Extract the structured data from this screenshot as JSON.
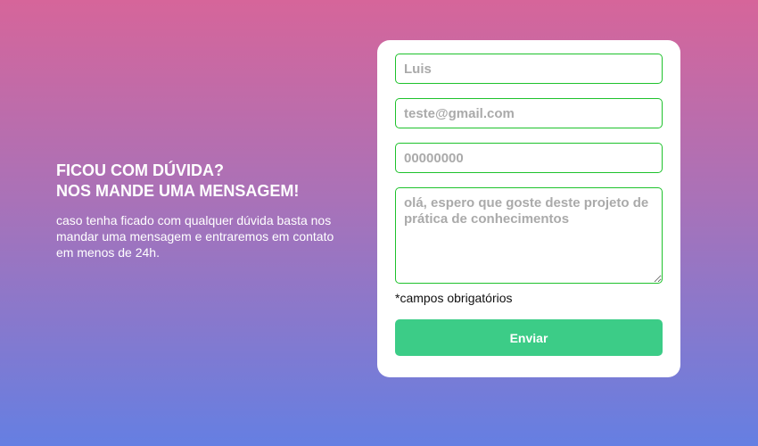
{
  "intro": {
    "title_line1": "FICOU COM DÚVIDA?",
    "title_line2": "NOS MANDE UMA MENSAGEM!",
    "text": "caso tenha ficado com qualquer dúvida basta nos mandar uma mensagem e entraremos em contato em menos de 24h."
  },
  "form": {
    "name_placeholder": "Luis",
    "email_placeholder": "teste@gmail.com",
    "phone_placeholder": "00000000",
    "message_placeholder": "olá, espero que goste deste projeto de prática de conhecimentos",
    "required_note": "*campos obrigatórios",
    "submit_label": "Enviar"
  },
  "colors": {
    "accent": "#3ccc87",
    "field_border": "#1ec22c"
  }
}
